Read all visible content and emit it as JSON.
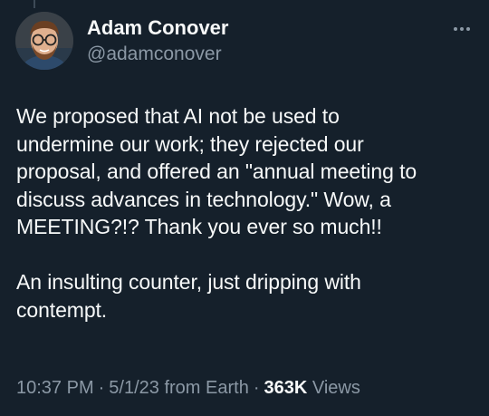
{
  "author": {
    "display_name": "Adam Conover",
    "handle": "@adamconover",
    "avatar_icon": "profile-photo"
  },
  "menu": {
    "more_icon": "ellipsis-horizontal-icon"
  },
  "tweet": {
    "paragraphs": [
      "We proposed that AI not be used to\nundermine our work; they rejected our\nproposal, and offered an \"annual meeting to\ndiscuss advances in technology.\" Wow, a\nMEETING?!? Thank you ever so much!!",
      "An insulting counter, just dripping with\ncontempt."
    ]
  },
  "meta": {
    "time": "10:37 PM",
    "separator": "·",
    "date": "5/1/23",
    "source": "from Earth",
    "views_count": "363K",
    "views_label": "Views"
  },
  "colors": {
    "background": "#15202b",
    "primary_text": "#f7f9f9",
    "secondary_text": "#8b98a5"
  }
}
